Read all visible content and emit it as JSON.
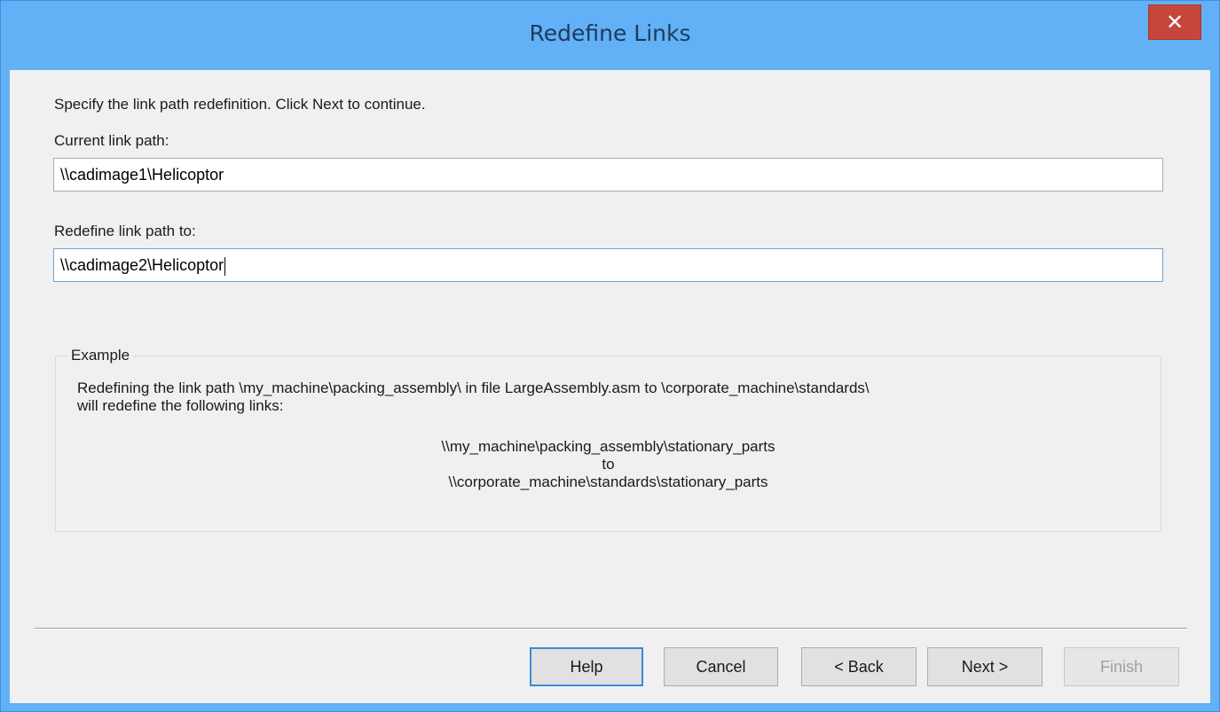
{
  "window": {
    "title": "Redefine Links",
    "close_glyph": "✕"
  },
  "instructions": "Specify the link path redefinition. Click Next to continue.",
  "current_link": {
    "label": "Current link path:",
    "value": "\\\\cadimage1\\Helicoptor"
  },
  "redefine_link": {
    "label": "Redefine link path to:",
    "value": "\\\\cadimage2\\Helicoptor"
  },
  "example": {
    "legend": "Example",
    "line1": "Redefining the link path \\my_machine\\packing_assembly\\ in file LargeAssembly.asm to \\corporate_machine\\standards\\",
    "line2": "will redefine the following links:",
    "from_path": "\\\\my_machine\\packing_assembly\\stationary_parts",
    "to_word": "to",
    "to_path": "\\\\corporate_machine\\standards\\stationary_parts"
  },
  "buttons": {
    "help": "Help",
    "cancel": "Cancel",
    "back": "< Back",
    "next": "Next >",
    "finish": "Finish"
  },
  "colors": {
    "title_bar": "#62b1f6",
    "close_button": "#c7463c",
    "dialog_background": "#f0f0f0",
    "focus_border": "#3c8ad8"
  },
  "icons": {
    "close": "close-icon"
  }
}
